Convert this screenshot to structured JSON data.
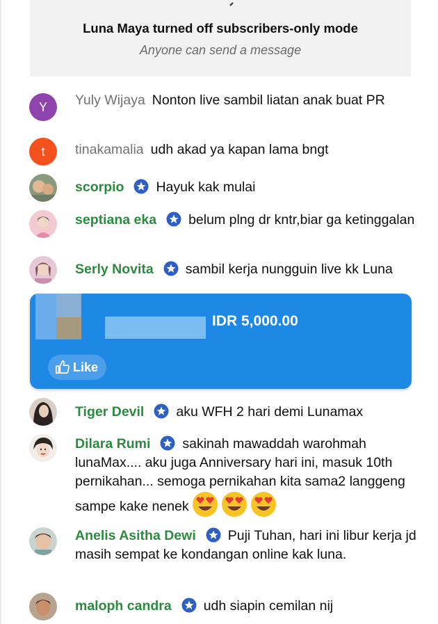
{
  "banner": {
    "title": "Luna Maya turned off subscribers-only mode",
    "subtitle": "Anyone can send a message"
  },
  "messages": [
    {
      "author": "Yuly Wijaya",
      "text": "Nonton live sambil liatan anak buat PR",
      "avatar_letter": "Y",
      "avatar_color": "#8e44ad"
    },
    {
      "author": "tinakamalia",
      "text": "udh akad ya kapan lama bngt",
      "avatar_letter": "t",
      "avatar_color": "#f4511e"
    },
    {
      "author": "scorpio",
      "text": "Hayuk kak mulai"
    },
    {
      "author": "septiana eka",
      "text": "belum plng dr kntr,biar ga ketinggalan"
    },
    {
      "author": "Serly Novita",
      "text": "sambil kerja nungguin live kk Luna"
    },
    {
      "author": "Tiger Devil",
      "text": "aku WFH 2 hari demi Lunamax"
    },
    {
      "author": "Dilara Rumi",
      "text": "sakinah mawaddah warohmah lunaMax.... aku juga Anniversary hari ini, masuk 10th pernikahan... semoga pernikahan kita sama2 langgeng sampe kake nenek"
    },
    {
      "author": "Anelis Asitha Dewi",
      "text": "Puji Tuhan, hari ini libur kerja jd masih sempat ke kondangan online kak luna."
    },
    {
      "author": "maloph candra",
      "text": "udh siapin cemilan nij"
    }
  ],
  "superchat": {
    "amount": "IDR 5,000.00",
    "like_label": "Like",
    "color": "#1e88e5"
  },
  "colors": {
    "member_name": "#2b8a3e",
    "plain_name": "#717171",
    "badge": "#2e5fc7"
  }
}
